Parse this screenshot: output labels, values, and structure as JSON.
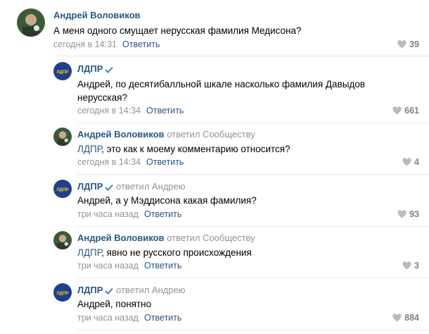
{
  "comments": [
    {
      "author": "Андрей Воловиков",
      "replied_to": "",
      "text": "А меня одного смущает нерусская фамилия Медисона?",
      "time": "сегодня в 14:31",
      "reply_label": "Ответить",
      "likes": "39"
    },
    {
      "author": "ЛДПР",
      "replied_to": "",
      "text": "Андрей, по десятибалльной шкале насколько фамилия Давыдов нерусская?",
      "time": "сегодня в 14:34",
      "reply_label": "Ответить",
      "likes": "661"
    },
    {
      "author": "Андрей Воловиков",
      "replied_to": "ответил Сообществу",
      "text_link": "ЛДПР",
      "text": ", это как к моему комментарию относится?",
      "time": "сегодня в 14:34",
      "reply_label": "Ответить",
      "likes": "4"
    },
    {
      "author": "ЛДПР",
      "replied_to": "ответил Андрею",
      "text": "Андрей, а у Мэддисона какая фамилия?",
      "time": "три часа назад",
      "reply_label": "Ответить",
      "likes": "93"
    },
    {
      "author": "Андрей Воловиков",
      "replied_to": "ответил Сообществу",
      "text_link": "ЛДПР",
      "text": ", явно не русского происхождения",
      "time": "три часа назад",
      "reply_label": "Ответить",
      "likes": "3"
    },
    {
      "author": "ЛДПР",
      "replied_to": "ответил Андрею",
      "text": "Андрей, понятно",
      "time": "три часа назад",
      "reply_label": "Ответить",
      "likes": "884"
    }
  ],
  "icons": {
    "verified": "checkmark-icon",
    "like": "heart-icon"
  },
  "colors": {
    "link": "#2a5885",
    "meta": "#939393",
    "likes": "#828282",
    "verified": "#5181b8",
    "ldpr_avatar_bg": "#1f3f8c"
  }
}
